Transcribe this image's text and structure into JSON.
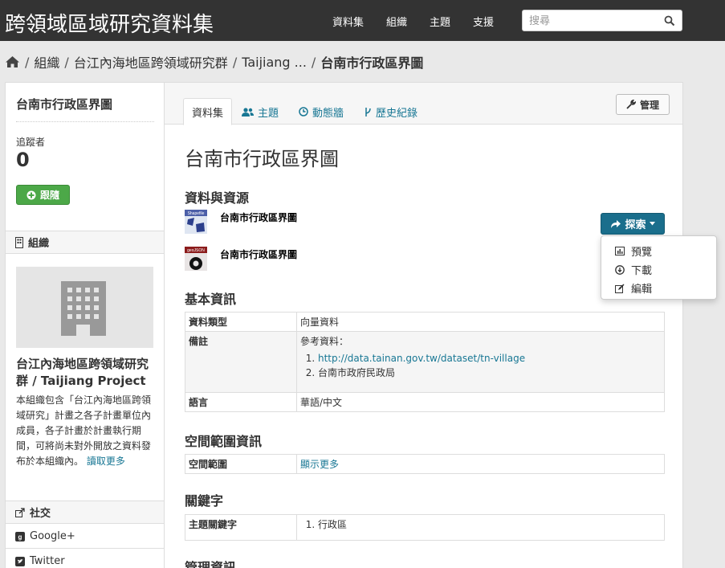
{
  "site": {
    "title": "跨領域區域研究資料集"
  },
  "nav": {
    "items": [
      "資料集",
      "組織",
      "主題",
      "支援"
    ]
  },
  "search": {
    "placeholder": "搜尋"
  },
  "breadcrumb": {
    "items": [
      "組織",
      "台江內海地區跨領域研究群",
      "Taijiang ..."
    ],
    "active": "台南市行政區界圖"
  },
  "sidebar": {
    "title": "台南市行政區界圖",
    "followers_label": "追蹤者",
    "followers_count": "0",
    "follow_button": "跟隨",
    "org_section": "組織",
    "org_name": "台江內海地區跨領域研究群 / Taijiang Project",
    "org_description": "本組織包含「台江內海地區跨領域研究」計畫之各子計畫單位內成員，各子計畫於計畫執行期間，可將尚未對外開放之資料發布於本組織內。",
    "read_more": "讀取更多",
    "social_section": "社交",
    "social_links": [
      "Google+",
      "Twitter"
    ]
  },
  "tabs": [
    {
      "label": "資料集",
      "icon": "none"
    },
    {
      "label": "主題",
      "icon": "users-icon"
    },
    {
      "label": "動態牆",
      "icon": "clock-icon"
    },
    {
      "label": "歷史紀錄",
      "icon": "branch-icon"
    }
  ],
  "manage_button": "管理",
  "dataset": {
    "title": "台南市行政區界圖",
    "resources_heading": "資料與資源",
    "resources": [
      {
        "name": "台南市行政區界圖",
        "format": "Shapefile"
      },
      {
        "name": "台南市行政區界圖",
        "format": "geoJSON"
      }
    ],
    "explore_button": "探索",
    "explore_menu": [
      "預覽",
      "下載",
      "編輯"
    ],
    "basic_heading": "基本資訊",
    "basic_info": {
      "type_key": "資料類型",
      "type_value": "向量資料",
      "note_key": "備註",
      "note_intro": "參考資料：",
      "note_items": [
        "http://data.tainan.gov.tw/dataset/tn-village",
        "台南市政府民政局"
      ],
      "lang_key": "語言",
      "lang_value": "華語/中文"
    },
    "spatial_heading": "空間範圍資訊",
    "spatial": {
      "key": "空間範圍",
      "value": "顯示更多"
    },
    "keywords_heading": "關鍵字",
    "keywords": {
      "key": "主題關鍵字",
      "items": [
        "行政區"
      ]
    },
    "admin_heading": "管理資訊"
  }
}
